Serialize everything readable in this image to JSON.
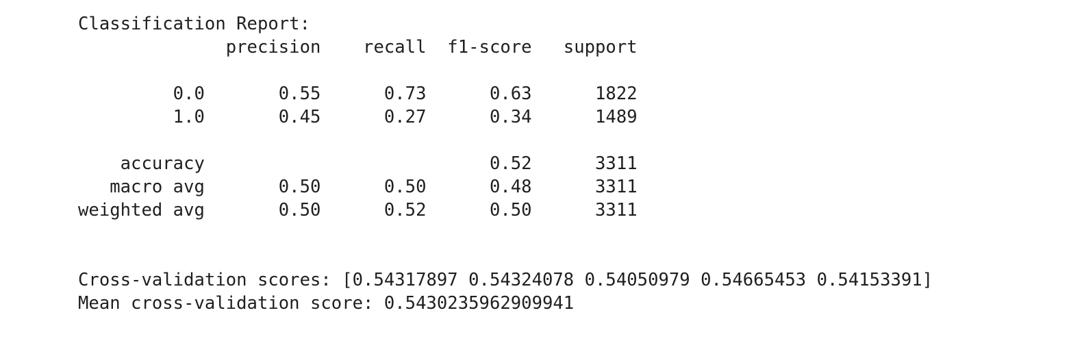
{
  "report": {
    "title": "Classification Report:",
    "header": "              precision    recall  f1-score   support",
    "rows": [
      "         0.0       0.55      0.73      0.63      1822",
      "         1.0       0.45      0.27      0.34      1489",
      "    accuracy                           0.52      3311",
      "   macro avg       0.50      0.50      0.48      3311",
      "weighted avg       0.50      0.52      0.50      3311"
    ]
  },
  "cross_validation": {
    "scores_line": "Cross-validation scores: [0.54317897 0.54324078 0.54050979 0.54665453 0.54153391]",
    "mean_line": "Mean cross-validation score: 0.5430235962909941"
  }
}
